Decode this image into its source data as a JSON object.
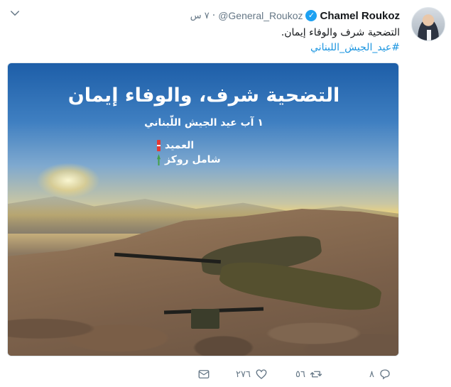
{
  "tweet": {
    "display_name": "Chamel Roukoz",
    "verified_mark": "✓",
    "handle": "@General_Roukoz",
    "separator": "·",
    "timestamp": "٧ س",
    "text": "التضحية شرف والوفاء إيمان.",
    "hashtag": "#عيد_الجيش_اللبناني"
  },
  "media": {
    "poster_title": "التضحية شرف، والوفاء إيمان",
    "poster_subtitle": "١ آب عيد الجيش اللّبناني",
    "signature_line1": "العميد",
    "signature_line2": "شامل روكز"
  },
  "actions": {
    "reply_count": "٨",
    "retweet_count": "٥٦",
    "like_count": "٢٧٦"
  },
  "icons": {
    "caret": "chevron-down-icon",
    "verified": "verified-badge-icon",
    "reply": "reply-icon",
    "retweet": "retweet-icon",
    "like": "heart-icon",
    "dm": "envelope-icon"
  },
  "colors": {
    "link": "#1b95e0",
    "verified": "#1da1f2",
    "muted": "#657786"
  }
}
